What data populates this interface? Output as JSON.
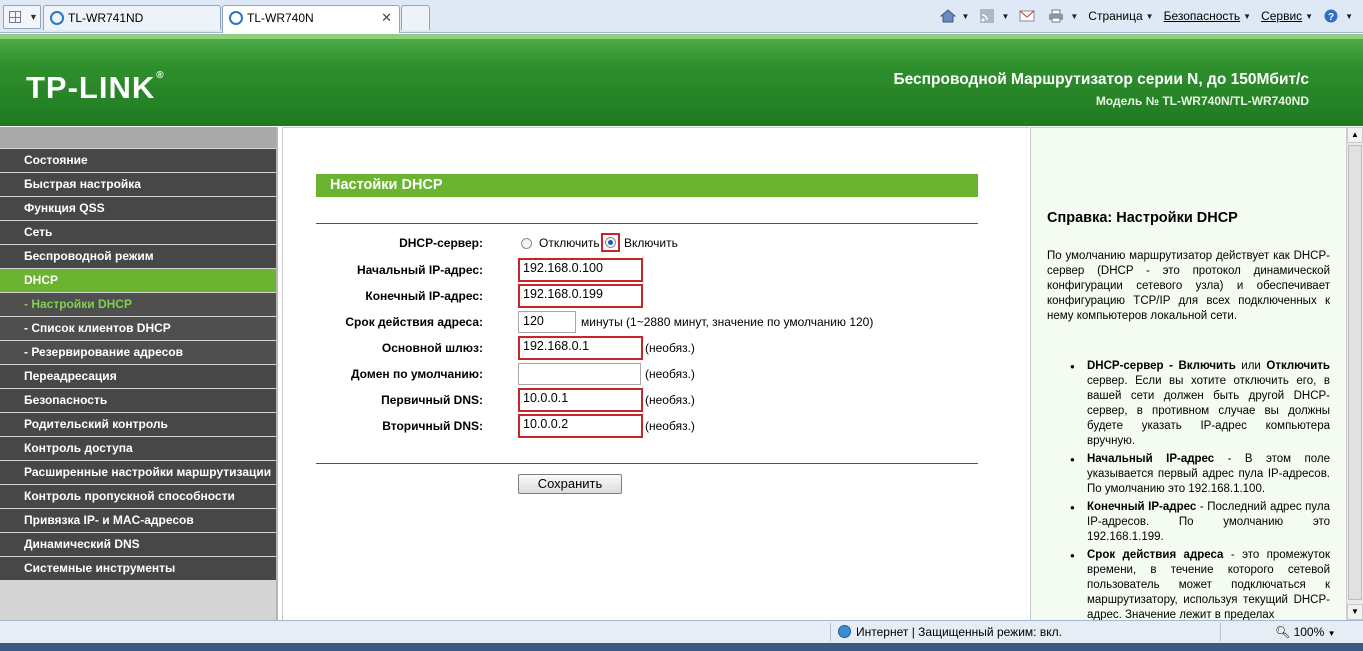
{
  "browser": {
    "tabs": [
      {
        "label": "TL-WR741ND"
      },
      {
        "label": "TL-WR740N"
      }
    ],
    "toolbar": {
      "page_label": "Страница",
      "security_label": "Безопасность",
      "service_label": "Сервис"
    },
    "status": {
      "zone": "Интернет | Защищенный режим: вкл.",
      "zoom": "100%"
    }
  },
  "header": {
    "logo": "TP-LINK",
    "title": "Беспроводной Маршрутизатор серии N, до 150Мбит/с",
    "model": "Модель № TL-WR740N/TL-WR740ND"
  },
  "menu": {
    "items": [
      "Состояние",
      "Быстрая настройка",
      "Функция QSS",
      "Сеть",
      "Беспроводной режим",
      "DHCP",
      "- Настройки DHCP",
      "- Список клиентов DHCP",
      "- Резервирование адресов",
      "Переадресация",
      "Безопасность",
      "Родительский контроль",
      "Контроль доступа",
      "Расширенные настройки маршрутизации",
      "Контроль пропускной способности",
      "Привязка IP- и MAC-адресов",
      "Динамический DNS",
      "Системные инструменты"
    ]
  },
  "form": {
    "heading": "Настойки DHCP",
    "server_label": "DHCP-сервер:",
    "disable_label": "Отключить",
    "enable_label": "Включить",
    "start_label": "Начальный IP-адрес:",
    "start_value": "192.168.0.100",
    "end_label": "Конечный IP-адрес:",
    "end_value": "192.168.0.199",
    "lease_label": "Срок действия адреса:",
    "lease_value": "120",
    "lease_note": "минуты (1~2880 минут, значение по умолчанию 120)",
    "gateway_label": "Основной шлюз:",
    "gateway_value": "192.168.0.1",
    "domain_label": "Домен по умолчанию:",
    "domain_value": "",
    "dns1_label": "Первичный DNS:",
    "dns1_value": "10.0.0.1",
    "dns2_label": "Вторичный DNS:",
    "dns2_value": "10.0.0.2",
    "optional": "(необяз.)",
    "save_label": "Сохранить"
  },
  "help": {
    "title": "Справка: Настройки DHCP",
    "intro": "По умолчанию маршрутизатор действует как DHCP-сервер (DHCP - это протокол динамической конфигурации сетевого узла) и обеспечивает конфигурацию TCP/IP для всех подключенных к нему компьютеров локальной сети.",
    "item1_term": "DHCP-сервер - Включить",
    "item1_or": " или ",
    "item1_term2": "Отключить",
    "item1_text": " сервер. Если вы хотите отключить его, в вашей сети должен быть другой DHCP-сервер, в противном случае вы должны будете указать IP-адрес компьютера вручную.",
    "item2_term": "Начальный IP-адрес",
    "item2_text": " - В этом поле указывается первый адрес пула IP-адресов. По умолчанию это 192.168.1.100.",
    "item3_term": "Конечный IP-адрес",
    "item3_text": " - Последний адрес пула IP-адресов. По умолчанию это 192.168.1.199.",
    "item4_term": "Срок действия адреса",
    "item4_text": " - это промежуток времени, в течение которого сетевой пользователь может подключаться к маршрутизатору, используя текущий DHCP-адрес. Значение лежит в пределах"
  },
  "colors": {
    "accent_green": "#6ab430",
    "header_green": "#2f8f2c",
    "menu_dark": "#474747",
    "highlight_red": "#c6262b"
  }
}
